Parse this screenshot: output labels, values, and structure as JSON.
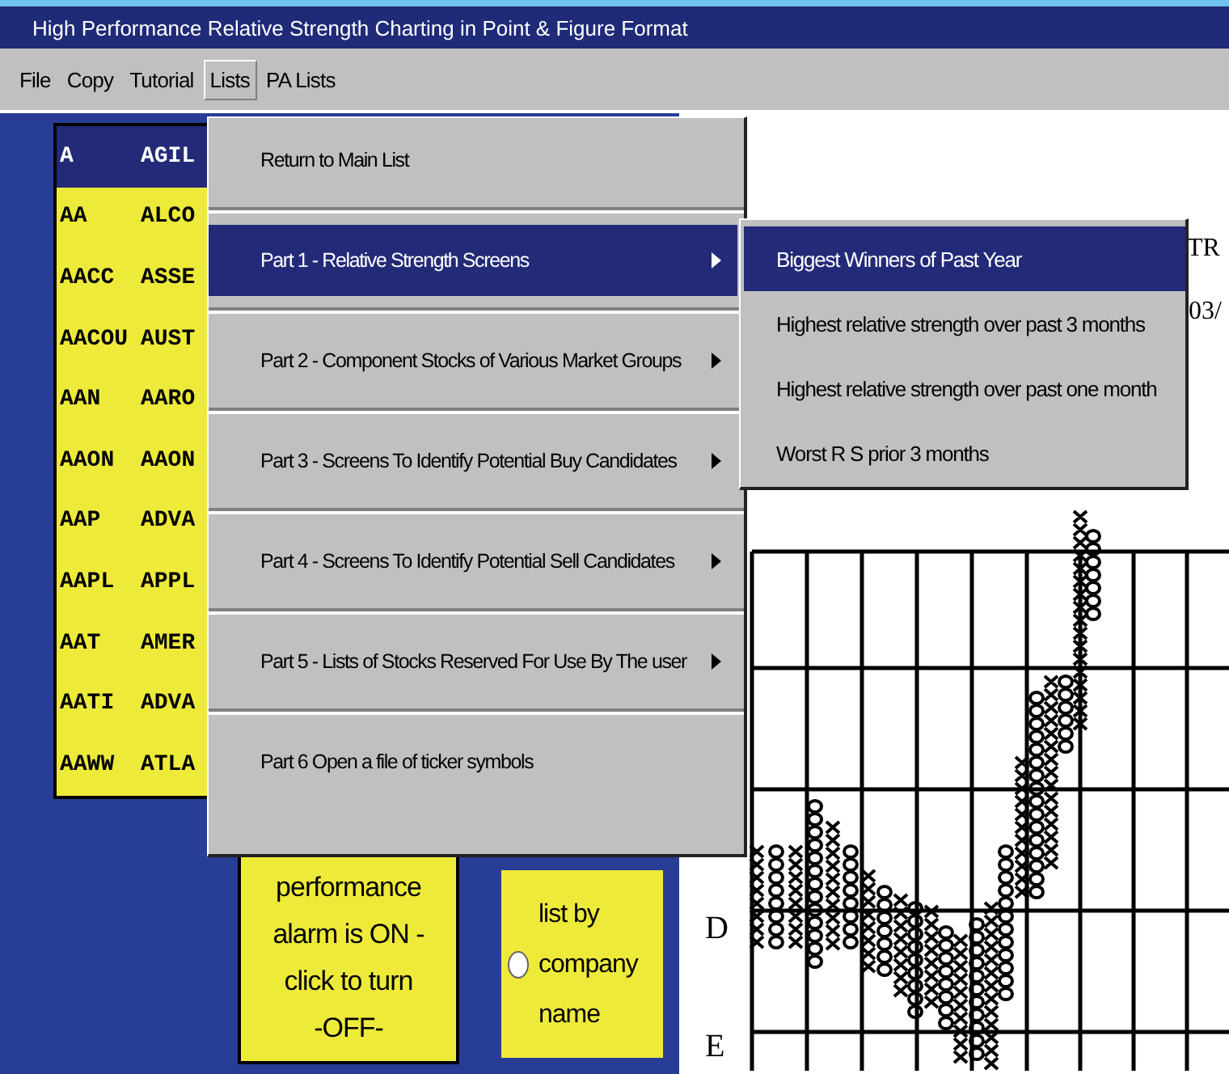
{
  "window": {
    "title": "High Performance Relative Strength Charting in Point & Figure Format"
  },
  "menu_bar": [
    {
      "label": "File",
      "selected": false
    },
    {
      "label": "Copy",
      "selected": false
    },
    {
      "label": "Tutorial",
      "selected": false
    },
    {
      "label": "Lists",
      "selected": true
    },
    {
      "label": "PA Lists",
      "selected": false
    }
  ],
  "ticker_list": [
    {
      "symbol": "A",
      "name": "AGIL",
      "selected": true
    },
    {
      "symbol": "AA",
      "name": "ALCO",
      "selected": false
    },
    {
      "symbol": "AACC",
      "name": "ASSE",
      "selected": false
    },
    {
      "symbol": "AACOU",
      "name": "AUST",
      "selected": false
    },
    {
      "symbol": "AAN",
      "name": "AARO",
      "selected": false
    },
    {
      "symbol": "AAON",
      "name": "AAON",
      "selected": false
    },
    {
      "symbol": "AAP",
      "name": "ADVA",
      "selected": false
    },
    {
      "symbol": "AAPL",
      "name": "APPL",
      "selected": false
    },
    {
      "symbol": "AAT",
      "name": "AMER",
      "selected": false
    },
    {
      "symbol": "AATI",
      "name": "ADVA",
      "selected": false
    },
    {
      "symbol": "AAWW",
      "name": "ATLA",
      "selected": false
    }
  ],
  "lists_menu": [
    {
      "label": "Return to Main List",
      "selected": false,
      "submenu": false
    },
    {
      "label": "Part 1 - Relative Strength Screens",
      "selected": true,
      "submenu": true
    },
    {
      "label": "Part 2 - Component Stocks of Various Market Groups",
      "selected": false,
      "submenu": true
    },
    {
      "label": "Part 3 - Screens To Identify Potential Buy Candidates",
      "selected": false,
      "submenu": true
    },
    {
      "label": "Part 4 - Screens To Identify Potential Sell Candidates",
      "selected": false,
      "submenu": true
    },
    {
      "label": "Part 5 - Lists of Stocks Reserved For Use By The user",
      "selected": false,
      "submenu": true
    },
    {
      "label": "Part 6  Open a file of ticker symbols",
      "selected": false,
      "submenu": false
    }
  ],
  "submenu": [
    {
      "label": "Biggest Winners of Past Year",
      "selected": true
    },
    {
      "label": "Highest relative strength over past 3 months",
      "selected": false
    },
    {
      "label": "Highest relative strength over past one month",
      "selected": false
    },
    {
      "label": "Worst R S prior 3 months",
      "selected": false
    }
  ],
  "alarm_button": {
    "lines": [
      "performance",
      "alarm is ON -",
      "click to turn",
      "-OFF-"
    ]
  },
  "sort_option": {
    "lines": [
      "list by",
      "company",
      "name"
    ],
    "checked": false
  },
  "chart": {
    "title_fragment": "TR",
    "date_fragment": "03/",
    "row_labels": [
      "D",
      "E"
    ]
  }
}
